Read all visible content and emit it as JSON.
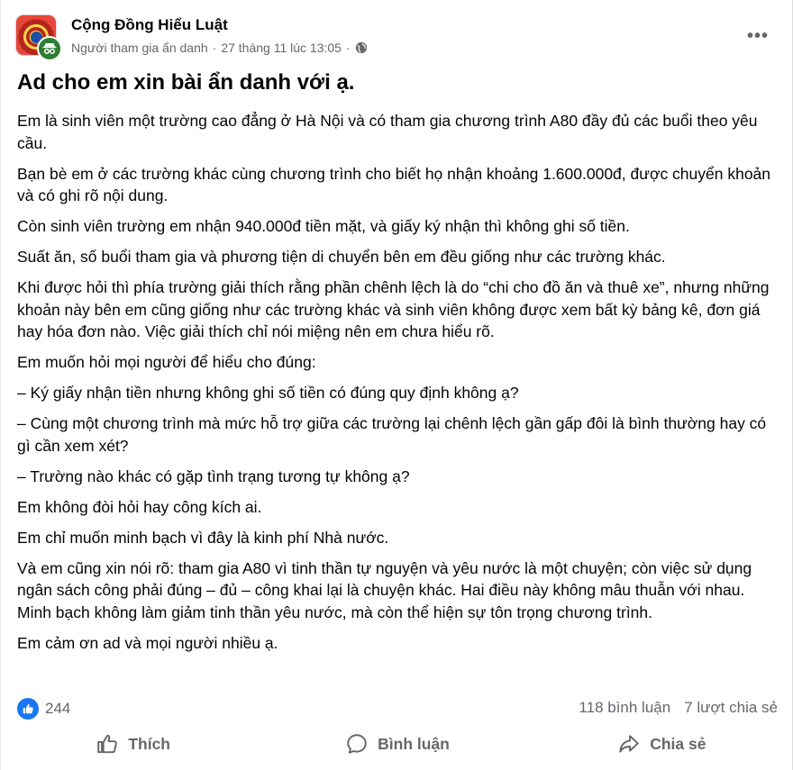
{
  "header": {
    "group_name": "Cộng Đồng Hiểu Luật",
    "author": "Người tham gia ẩn danh",
    "separator": "·",
    "timestamp": "27 tháng 11 lúc 13:05",
    "privacy_icon": "globe-icon",
    "more_icon": "more-horizontal-icon",
    "more_label": "•••"
  },
  "post": {
    "title": "Ad cho em xin bài ẩn danh với ạ.",
    "paragraphs": [
      "Em là sinh viên một trường cao đẳng ở Hà Nội và có tham gia chương trình A80 đầy đủ các buổi theo yêu cầu.",
      "Bạn bè em ở các trường khác cùng chương trình cho biết họ nhận khoảng 1.600.000đ, được chuyển khoản và có ghi rõ nội dung.",
      "Còn sinh viên trường em nhận 940.000đ tiền mặt, và giấy ký nhận thì không ghi số tiền.",
      "Suất ăn, số buổi tham gia và phương tiện di chuyển bên em đều giống như các trường khác.",
      "Khi được hỏi thì phía trường giải thích rằng phần chênh lệch là do “chi cho đồ ăn và thuê xe”, nhưng những khoản này bên em cũng giống như các trường khác và sinh viên không được xem bất kỳ bảng kê, đơn giá hay hóa đơn nào. Việc giải thích chỉ nói miệng nên em chưa hiểu rõ.",
      "Em muốn hỏi mọi người để hiểu cho đúng:",
      "– Ký giấy nhận tiền nhưng không ghi số tiền có đúng quy định không ạ?",
      "– Cùng một chương trình mà mức hỗ trợ giữa các trường lại chênh lệch gần gấp đôi là bình thường hay có gì cần xem xét?",
      "– Trường nào khác có gặp tình trạng tương tự không ạ?",
      "Em không đòi hỏi hay công kích ai.",
      "Em chỉ muốn minh bạch vì đây là kinh phí Nhà nước.",
      "Và em cũng xin nói rõ: tham gia A80 vì tinh thần tự nguyện và yêu nước là một chuyện; còn việc sử dụng ngân sách công phải đúng – đủ – công khai lại là chuyện khác. Hai điều này không mâu thuẫn với nhau. Minh bạch không làm giảm tinh thần yêu nước, mà còn thể hiện sự tôn trọng chương trình.",
      "Em cảm ơn ad và mọi người nhiều ạ."
    ]
  },
  "stats": {
    "reaction_icon": "like-reaction-icon",
    "reaction_count": "244",
    "comments": "118 bình luận",
    "shares": "7 lượt chia sẻ"
  },
  "actions": {
    "like": "Thích",
    "comment": "Bình luận",
    "share": "Chia sẻ"
  },
  "colors": {
    "brand_blue": "#1877f2",
    "secondary_text": "#65676b",
    "primary_text": "#050505",
    "anon_badge": "#2e7d32"
  }
}
